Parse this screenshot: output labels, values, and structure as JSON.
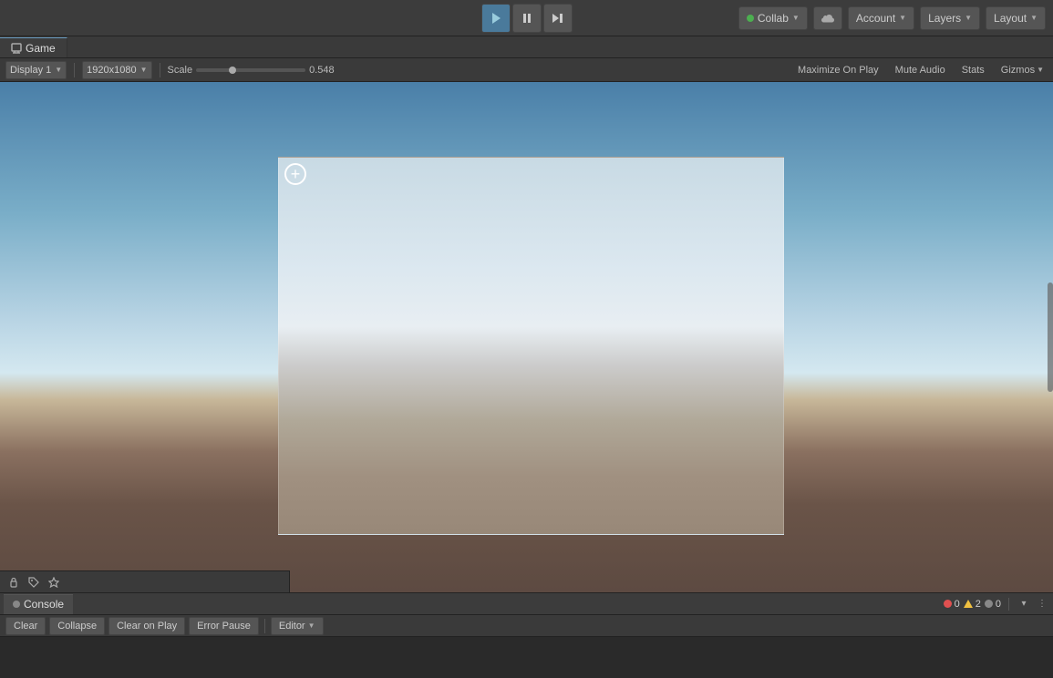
{
  "toolbar": {
    "play_label": "▶",
    "pause_label": "⏸",
    "step_label": "⏭",
    "collab_label": "Collab",
    "account_label": "Account",
    "layers_label": "Layers",
    "layout_label": "Layout"
  },
  "game_tab": {
    "label": "Game",
    "display_label": "Display 1",
    "resolution_label": "1920x1080",
    "scale_label": "Scale",
    "scale_value": "0.548",
    "maximize_on_play": "Maximize On Play",
    "mute_audio": "Mute Audio",
    "stats": "Stats",
    "gizmos": "Gizmos"
  },
  "console": {
    "tab_label": "Console",
    "clear_label": "Clear",
    "collapse_label": "Collapse",
    "clear_on_play_label": "Clear on Play",
    "error_pause_label": "Error Pause",
    "editor_label": "Editor",
    "count_info": "0",
    "count_warn": "2",
    "count_error": "0"
  }
}
